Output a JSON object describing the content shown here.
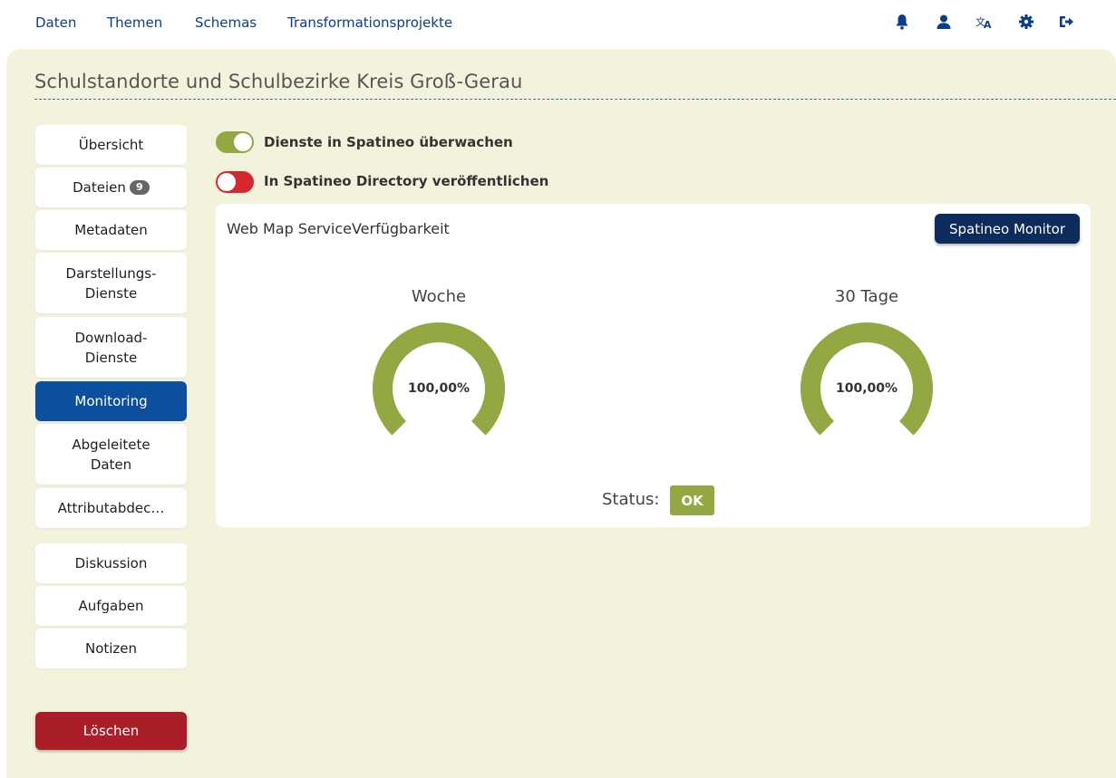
{
  "nav": {
    "links": [
      "Daten",
      "Themen",
      "Schemas",
      "Transformationsprojekte"
    ],
    "icons": [
      "bell-icon",
      "user-icon",
      "translate-icon",
      "gear-icon",
      "logout-icon"
    ]
  },
  "page": {
    "title": "Schulstandorte und Schulbezirke Kreis Groß-Gerau"
  },
  "sidebar": {
    "items": [
      {
        "label": "Übersicht"
      },
      {
        "label": "Dateien",
        "badge": "9"
      },
      {
        "label": "Metadaten"
      },
      {
        "label": "Darstellungs-Dienste"
      },
      {
        "label": "Download-Dienste"
      },
      {
        "label": "Monitoring",
        "active": true
      },
      {
        "label": "Abgeleitete Daten"
      },
      {
        "label": "Attributabdec…"
      },
      {
        "label": "Diskussion"
      },
      {
        "label": "Aufgaben"
      },
      {
        "label": "Notizen"
      }
    ],
    "delete_label": "Löschen"
  },
  "toggles": [
    {
      "label": "Dienste in Spatineo überwachen",
      "state": "on",
      "color": "#93a842"
    },
    {
      "label": "In Spatineo Directory veröffentlichen",
      "state": "off",
      "color": "#d8262f"
    }
  ],
  "card": {
    "title": "Web Map ServiceVerfügbarkeit",
    "monitor_button": "Spatineo Monitor",
    "gauges": [
      {
        "label": "Woche",
        "value_text": "100,00%",
        "value": 1.0,
        "color": "#93a842"
      },
      {
        "label": "30 Tage",
        "value_text": "100,00%",
        "value": 1.0,
        "color": "#93a842"
      }
    ],
    "status_label": "Status:",
    "status_value": "OK",
    "status_color": "#93a842"
  },
  "colors": {
    "nav": "#0b3e8a",
    "active": "#0b4f9e",
    "danger": "#a91e27",
    "panel": "#f3f3dd"
  }
}
